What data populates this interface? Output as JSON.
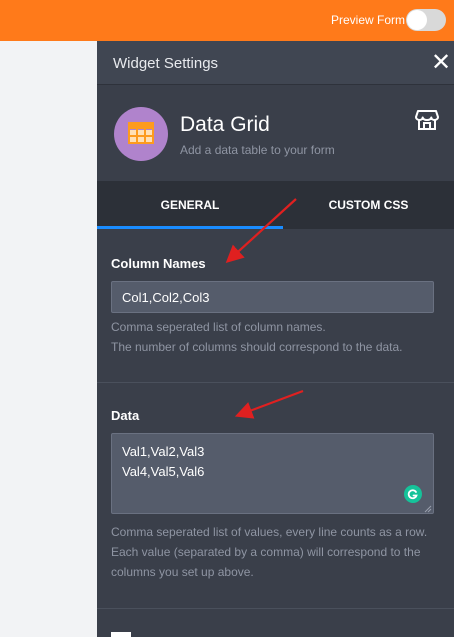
{
  "topbar": {
    "preview_label": "Preview Form",
    "preview_enabled": false,
    "color": "#ff7a1a"
  },
  "panel": {
    "title": "Widget Settings",
    "close_icon": "close-icon"
  },
  "widget": {
    "name": "Data Grid",
    "description": "Add a data table to your form",
    "icon": "grid-table-icon",
    "icon_color": "#b083cc",
    "store_icon": "store-icon"
  },
  "tabs": [
    {
      "label": "GENERAL",
      "active": true
    },
    {
      "label": "CUSTOM CSS",
      "active": false
    }
  ],
  "fields": {
    "column_names": {
      "label": "Column Names",
      "value": "Col1,Col2,Col3",
      "help_line1": "Comma seperated list of column names.",
      "help_line2": "The number of columns should correspond to the data."
    },
    "data": {
      "label": "Data",
      "value": "Val1,Val2,Val3\nVal4,Val5,Val6",
      "help_line1": "Comma seperated list of values, every line counts as a row.",
      "help_line2": "Each value (separated by a comma) will correspond to the",
      "help_line3": "columns you set up above."
    }
  },
  "annotations": {
    "arrow_color": "#e02020"
  }
}
